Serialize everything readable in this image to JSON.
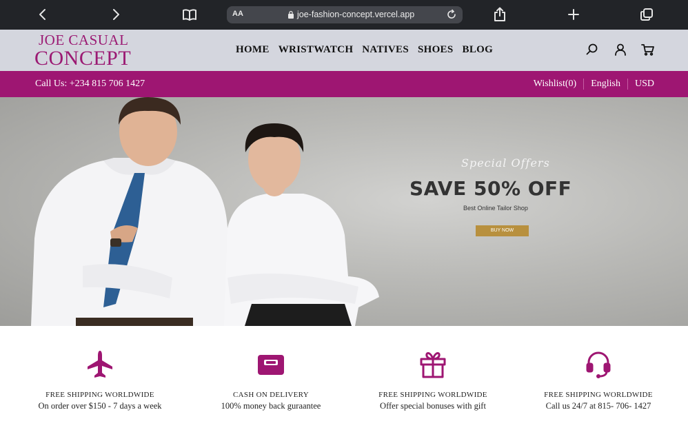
{
  "browser": {
    "text_size_button": "AA",
    "url": "joe-fashion-concept.vercel.app",
    "icons": [
      "back-icon",
      "forward-icon",
      "book-icon",
      "lock-icon",
      "reload-icon",
      "share-icon",
      "plus-icon",
      "tabs-icon"
    ]
  },
  "header": {
    "logo_top": "JOE CASUAL",
    "logo_bottom": "CONCEPT",
    "nav": [
      "HOME",
      "WRISTWATCH",
      "NATIVES",
      "SHOES",
      "BLOG"
    ],
    "icons": [
      "search-icon",
      "user-icon",
      "cart-icon"
    ]
  },
  "topbar": {
    "call": "Call Us: +234 815 706 1427",
    "wishlist": "Wishlist(0)",
    "language": "English",
    "currency": "USD"
  },
  "hero": {
    "special": "Special Offers",
    "headline": "SAVE 50% OFF",
    "subline": "Best Online Tailor Shop",
    "button": "BUY NOW"
  },
  "features": [
    {
      "icon": "airplane-icon",
      "title": "FREE SHIPPING WORLDWIDE",
      "subtitle": "On order over $150 - 7 days a week"
    },
    {
      "icon": "wallet-icon",
      "title": "CASH ON DELIVERY",
      "subtitle": "100% money back guraantee"
    },
    {
      "icon": "gift-icon",
      "title": "FREE SHIPPING WORLDWIDE",
      "subtitle": "Offer special bonuses with gift"
    },
    {
      "icon": "headset-icon",
      "title": "FREE SHIPPING WORLDWIDE",
      "subtitle": "Call us 24/7 at 815- 706- 1427"
    }
  ],
  "colors": {
    "brand": "#9e1672",
    "header_bg": "#d4d6de",
    "browser_bg": "#222428",
    "button_gold": "#b8903e"
  }
}
